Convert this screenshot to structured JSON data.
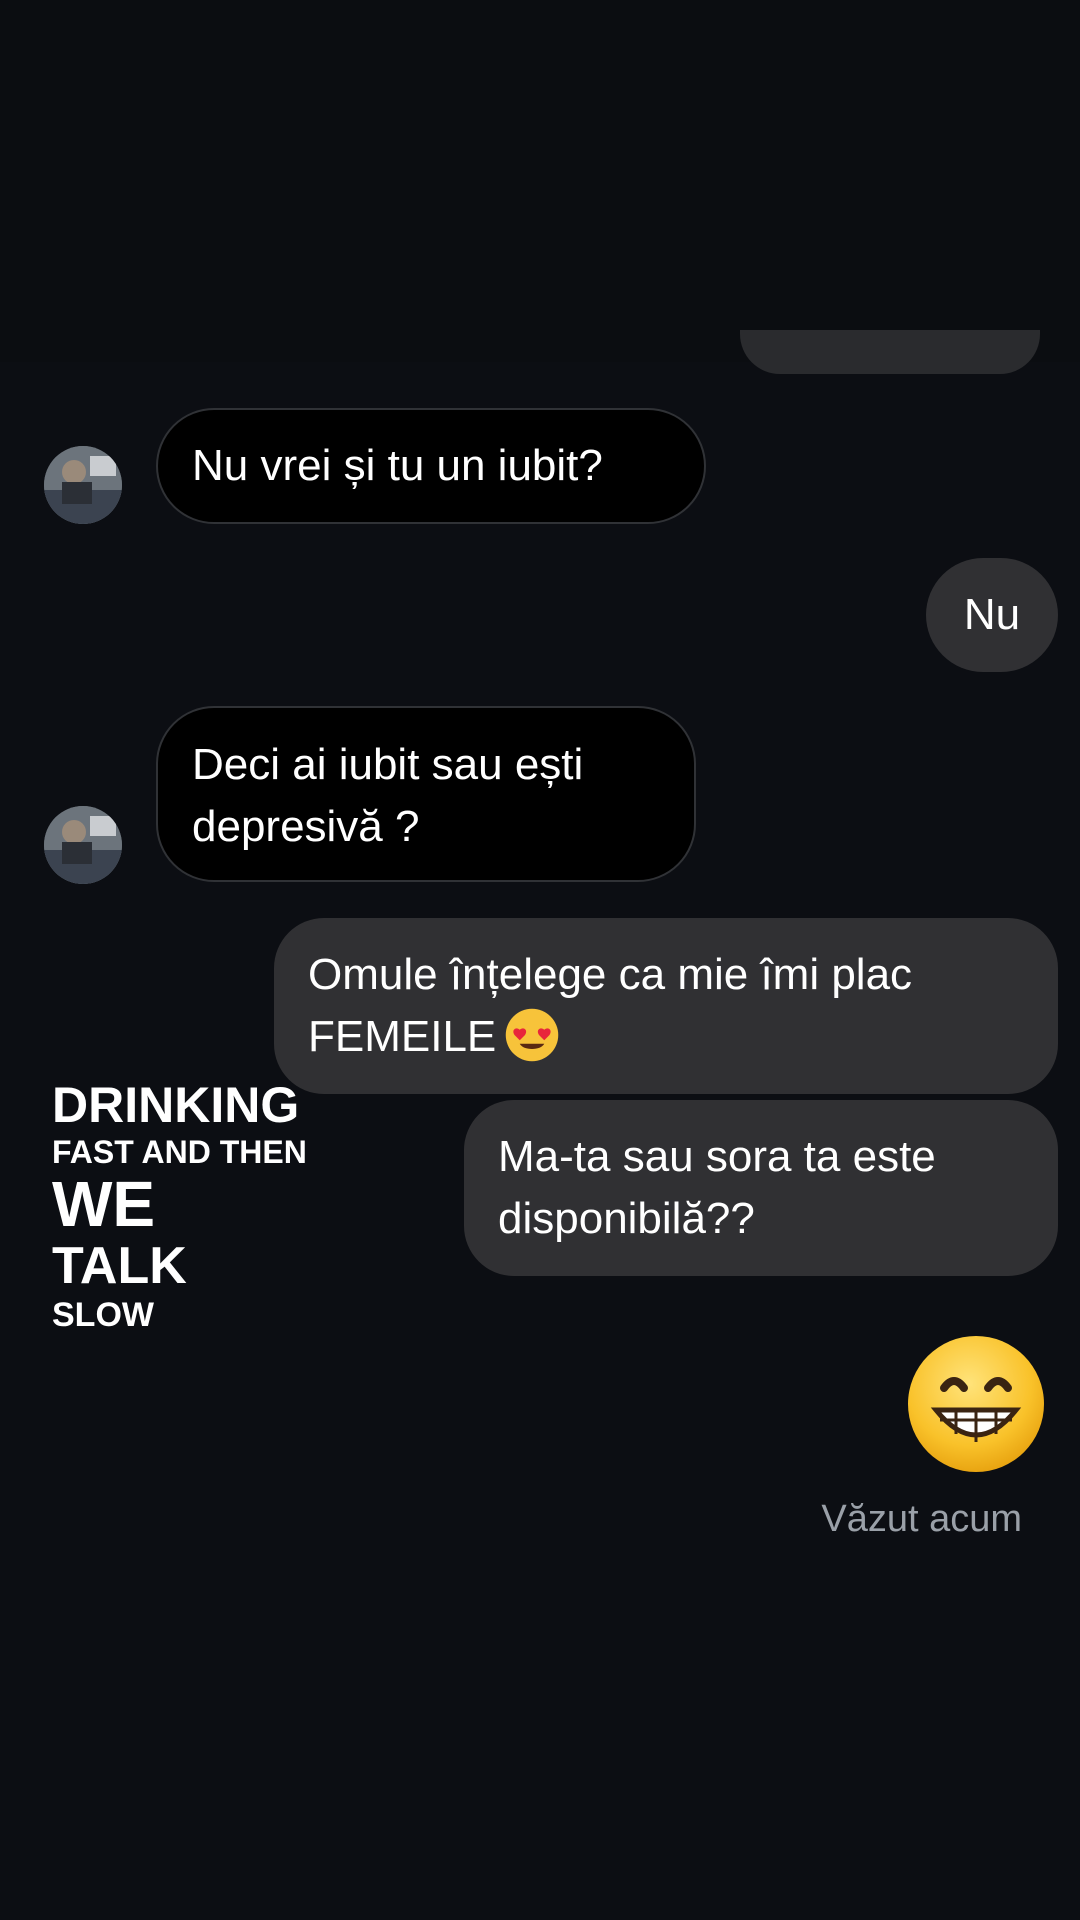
{
  "conversation": {
    "messages": [
      {
        "id": "m1",
        "sender": "them",
        "text": "Nu vrei și tu un iubit?"
      },
      {
        "id": "m2",
        "sender": "me",
        "text": "Nu"
      },
      {
        "id": "m3",
        "sender": "them",
        "text": "Deci ai iubit sau ești\ndepresivă ?"
      },
      {
        "id": "m4",
        "sender": "me",
        "text": "Omule înțelege ca mie îmi plac\nFEMEILE",
        "emoji": "heart-eyes-emoji"
      },
      {
        "id": "m5",
        "sender": "me",
        "text": "Ma-ta sau sora ta este\ndisponibilă??"
      },
      {
        "id": "m6",
        "sender": "me",
        "emoji": "grinning-face-emoji"
      }
    ],
    "seen_status": "Văzut acum"
  },
  "sticker": {
    "lines": [
      "DRINKING",
      "FAST AND THEN",
      "WE",
      "TALK",
      "SLOW"
    ]
  },
  "colors": {
    "background": "#0c0e13",
    "incoming_bubble": "#000000",
    "outgoing_bubble": "#303033",
    "text": "#ffffff",
    "seen_text": "#9aa0a8"
  }
}
